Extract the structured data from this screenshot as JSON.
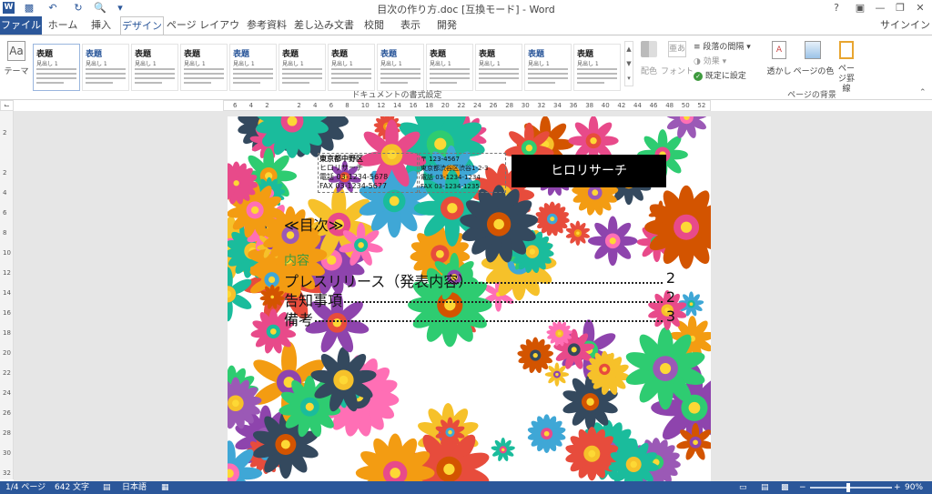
{
  "window": {
    "title": "目次の作り方.doc [互換モード] - Word",
    "app_icon": "word-icon",
    "qat": [
      "save-icon",
      "undo-icon",
      "redo-icon",
      "print-preview-icon",
      "customize-icon"
    ],
    "controls": [
      "help-icon",
      "ribbon-display-icon",
      "minimize-icon",
      "restore-icon",
      "close-icon"
    ]
  },
  "tabs": [
    "ファイル",
    "ホーム",
    "挿入",
    "デザイン",
    "ページ レイアウト",
    "参考資料",
    "差し込み文書",
    "校閲",
    "表示",
    "開発"
  ],
  "active_tab": "デザイン",
  "signin": "サインイン",
  "ribbon": {
    "theme_label": "テーマ",
    "style_gallery": [
      {
        "title": "表題"
      },
      {
        "title": "表題"
      },
      {
        "title": "表題"
      },
      {
        "title": "表題"
      },
      {
        "title": "表題"
      },
      {
        "title": "表題"
      },
      {
        "title": "表題"
      },
      {
        "title": "表題"
      },
      {
        "title": "表題"
      },
      {
        "title": "表題"
      },
      {
        "title": "表題"
      },
      {
        "title": "表題"
      }
    ],
    "gallery_sub": "見出し 1",
    "group_document_format": "ドキュメントの書式設定",
    "colors_label": "配色",
    "fonts_label": "フォント",
    "paragraph_spacing": "段落の間隔",
    "effects": "効果",
    "set_default": "既定に設定",
    "watermark": "透かし",
    "page_color": "ページの色",
    "page_borders": "ページ罫線",
    "group_page_background": "ページの背景"
  },
  "ruler": {
    "h": [
      "6",
      "4",
      "2",
      "",
      "2",
      "4",
      "6",
      "8",
      "10",
      "12",
      "14",
      "16",
      "18",
      "20",
      "22",
      "24",
      "26",
      "28",
      "30",
      "32",
      "34",
      "36",
      "38",
      "40",
      "42",
      "44",
      "46",
      "48",
      "50",
      "52"
    ],
    "v": [
      "2",
      "",
      "2",
      "4",
      "6",
      "8",
      "10",
      "12",
      "14",
      "16",
      "18",
      "20",
      "22",
      "24",
      "26",
      "28",
      "30",
      "32"
    ]
  },
  "document": {
    "address_left": {
      "title": "東京都中野区",
      "line1": "ヒロリサーチ",
      "line2": "電話 03-1234-5678",
      "line3": "FAX 03-1234-5677"
    },
    "address_right": {
      "line0": "〒 123-4567",
      "line1": "東京都渋谷区渋谷1-2-3",
      "line2": "電話 03-1234-1234",
      "line3": "FAX 03-1234-1235"
    },
    "company_box": "ヒロリサーチ",
    "toc_title": "≪目次≫",
    "contents_label": "内容",
    "toc": [
      {
        "text": "プレスリリース（発表内容）",
        "page": "2"
      },
      {
        "text": "告知事項",
        "page": "2"
      },
      {
        "text": "備考",
        "page": "3"
      }
    ]
  },
  "status": {
    "page": "1/4 ページ",
    "words": "642 文字",
    "lang": "日本語",
    "zoom": "90%"
  },
  "colors": {
    "brand": "#2b579a",
    "canvas": "#e6e6e6",
    "toc_heading": "#3e9a3e"
  }
}
